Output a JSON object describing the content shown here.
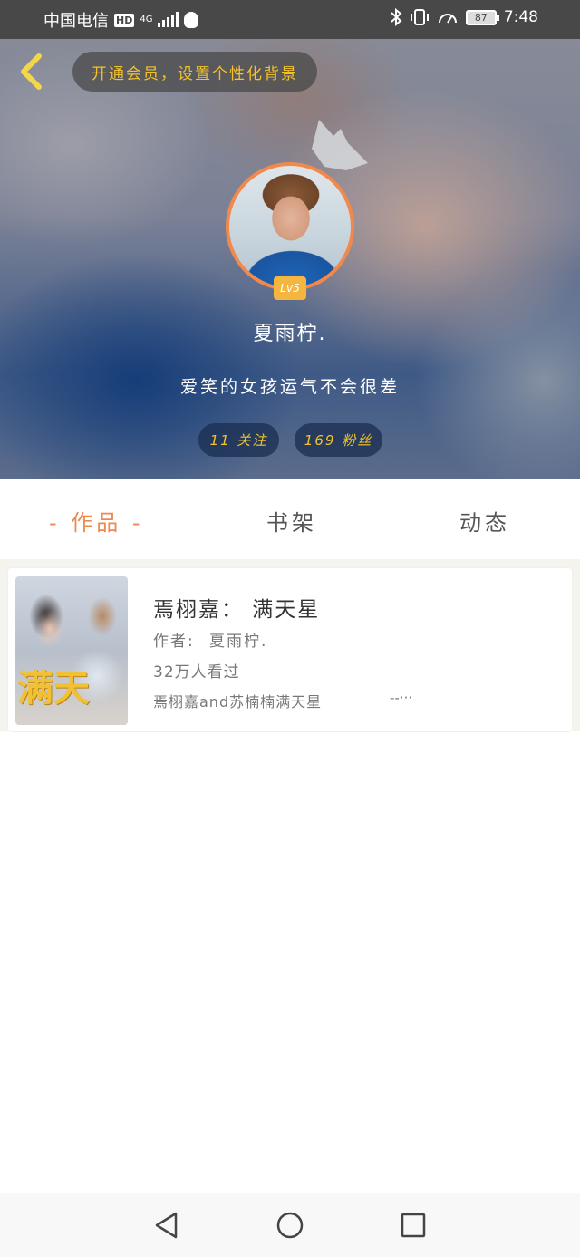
{
  "status_bar": {
    "carrier": "中国电信",
    "hd": "HD",
    "network": "4G",
    "battery": "87",
    "time": "7:48"
  },
  "header": {
    "vip_prompt": "开通会员，设置个性化背景"
  },
  "profile": {
    "level": "Lv5",
    "username": "夏雨柠.",
    "bio": "爱笑的女孩运气不会很差",
    "following": "11 关注",
    "fans": "169 粉丝"
  },
  "tabs": [
    {
      "label": "- 作品 -",
      "active": true
    },
    {
      "label": "书架",
      "active": false
    },
    {
      "label": "动态",
      "active": false
    }
  ],
  "works": [
    {
      "cover_text": "满天",
      "title": "焉栩嘉： 满天星",
      "author_label": "作者:",
      "author": "夏雨柠.",
      "views": "32万人看过",
      "description": "焉栩嘉and苏楠楠满天星",
      "more": "--···"
    }
  ],
  "colors": {
    "accent": "#ec8a52",
    "gold": "#f3c22c",
    "status_bar": "#484848"
  },
  "icons": [
    "back-arrow-icon",
    "crown-icon",
    "nav-back-icon",
    "nav-home-icon",
    "nav-recent-icon"
  ]
}
